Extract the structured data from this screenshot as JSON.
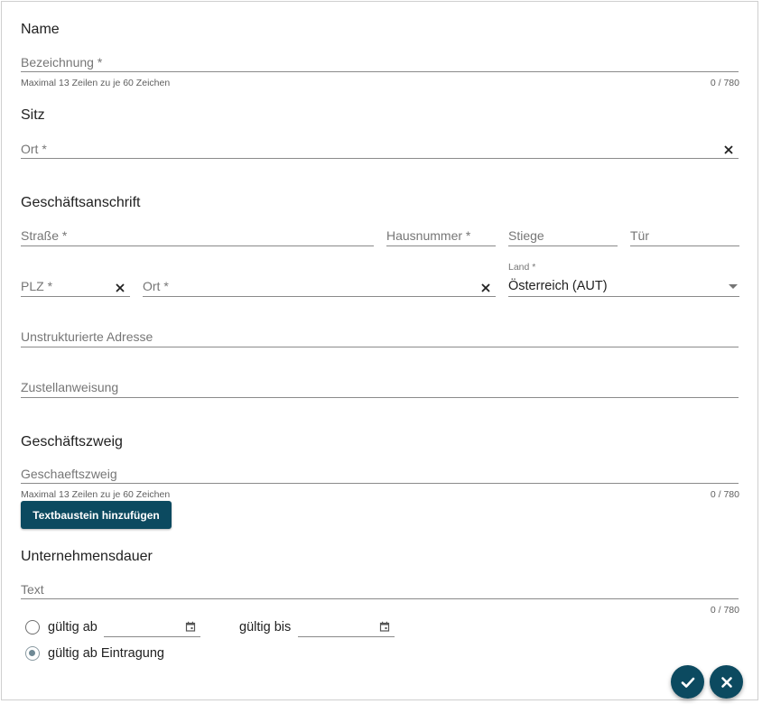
{
  "sections": {
    "name": "Name",
    "sitz": "Sitz",
    "anschrift": "Geschäftsanschrift",
    "zweig": "Geschäftszweig",
    "dauer": "Unternehmensdauer"
  },
  "name_field": {
    "placeholder": "Bezeichnung *",
    "hint": "Maximal 13 Zeilen zu je 60 Zeichen",
    "counter": "0 / 780"
  },
  "sitz_field": {
    "placeholder": "Ort *"
  },
  "address": {
    "street": "Straße *",
    "house_number": "Hausnummer *",
    "stair": "Stiege",
    "door": "Tür",
    "zip": "PLZ *",
    "city": "Ort *",
    "country_label": "Land *",
    "country_value": "Österreich (AUT)",
    "unstructured": "Unstrukturierte Adresse",
    "delivery_note": "Zustellanweisung"
  },
  "zweig_field": {
    "placeholder": "Geschaeftszweig",
    "hint": "Maximal 13 Zeilen zu je 60 Zeichen",
    "counter": "0 / 780",
    "add_button": "Textbaustein hinzufügen"
  },
  "dauer_field": {
    "placeholder": "Text",
    "counter": "0 / 780",
    "valid_from": "gültig ab",
    "valid_to": "gültig bis",
    "valid_from_registration": "gültig ab Eintragung",
    "selected_option": "gültig ab Eintragung"
  },
  "icons": {
    "clear": "close-icon",
    "dropdown": "arrow-drop-down-icon",
    "calendar": "calendar-icon",
    "confirm": "check-icon",
    "cancel": "close-icon"
  },
  "colors": {
    "primary": "#0c4a60"
  }
}
